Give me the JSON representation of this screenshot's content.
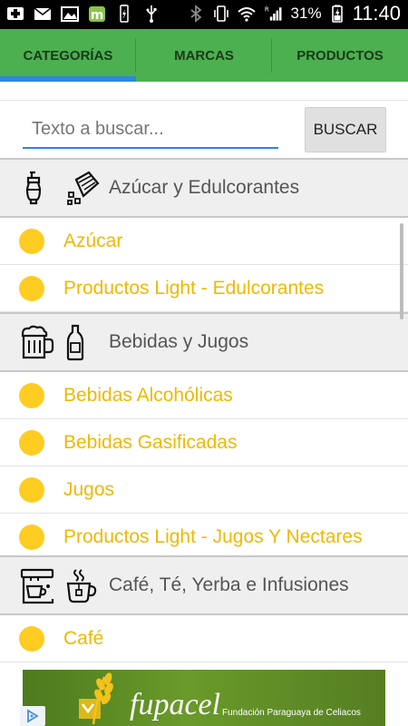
{
  "status_bar": {
    "battery_percent": "31%",
    "time": "11:40",
    "roaming_indicator": "R",
    "icons": [
      "hospital-plus-icon",
      "mail-icon",
      "image-icon",
      "market-icon",
      "battery-charging-icon",
      "usb-icon",
      "bluetooth-icon",
      "vibrate-icon",
      "wifi-icon",
      "signal-icon"
    ]
  },
  "tabs": [
    {
      "label": "CATEGORÍAS",
      "selected": true
    },
    {
      "label": "MARCAS",
      "selected": false
    },
    {
      "label": "PRODUCTOS",
      "selected": false
    }
  ],
  "search": {
    "placeholder": "Texto a buscar...",
    "value": "",
    "button_label": "BUSCAR"
  },
  "categories": [
    {
      "label": "Azúcar y Edulcorantes",
      "icons": [
        "sugar-shaker-icon",
        "sugar-bag-icon"
      ],
      "items": [
        "Azúcar",
        "Productos Light - Edulcorantes"
      ]
    },
    {
      "label": "Bebidas y Jugos",
      "icons": [
        "beer-mug-icon",
        "bottle-icon"
      ],
      "items": [
        "Bebidas Alcohólicas",
        "Bebidas Gasificadas",
        "Jugos",
        "Productos Light - Jugos Y Nectares"
      ]
    },
    {
      "label": "Café, Té, Yerba e Infusiones",
      "icons": [
        "coffee-machine-icon",
        "tea-cup-icon"
      ],
      "items": [
        "Café"
      ]
    }
  ],
  "ad": {
    "brand": "fupacel",
    "tagline": "Fundación Paraguaya de Celiacos"
  },
  "colors": {
    "tab_bar": "#4caf50",
    "tab_indicator": "#2e86de",
    "item_text": "#f0b800",
    "item_dot": "#ffcc22"
  }
}
